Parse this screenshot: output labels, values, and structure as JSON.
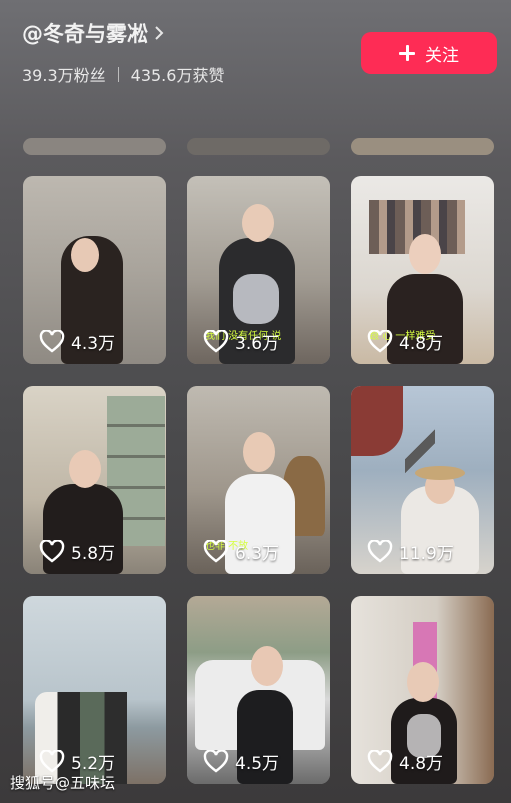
{
  "profile": {
    "username": "@冬奇与雾凇",
    "fans": "39.3万粉丝",
    "likes": "435.6万获赞",
    "follow_label": "关注"
  },
  "videos": [
    {
      "likes": "4.3万"
    },
    {
      "likes": "3.6万"
    },
    {
      "likes": "4.8万"
    },
    {
      "likes": "5.8万"
    },
    {
      "likes": "6.3万"
    },
    {
      "likes": "11.9万"
    },
    {
      "likes": "5.2万"
    },
    {
      "likes": "4.5万"
    },
    {
      "likes": "4.8万"
    }
  ],
  "captions": {
    "v2": "我们 没有任何 说",
    "v3": "跟 心 一样难受",
    "v5": "也非 不放"
  },
  "watermark": "搜狐号@五味坛",
  "colors": {
    "accent": "#fe2c55"
  }
}
